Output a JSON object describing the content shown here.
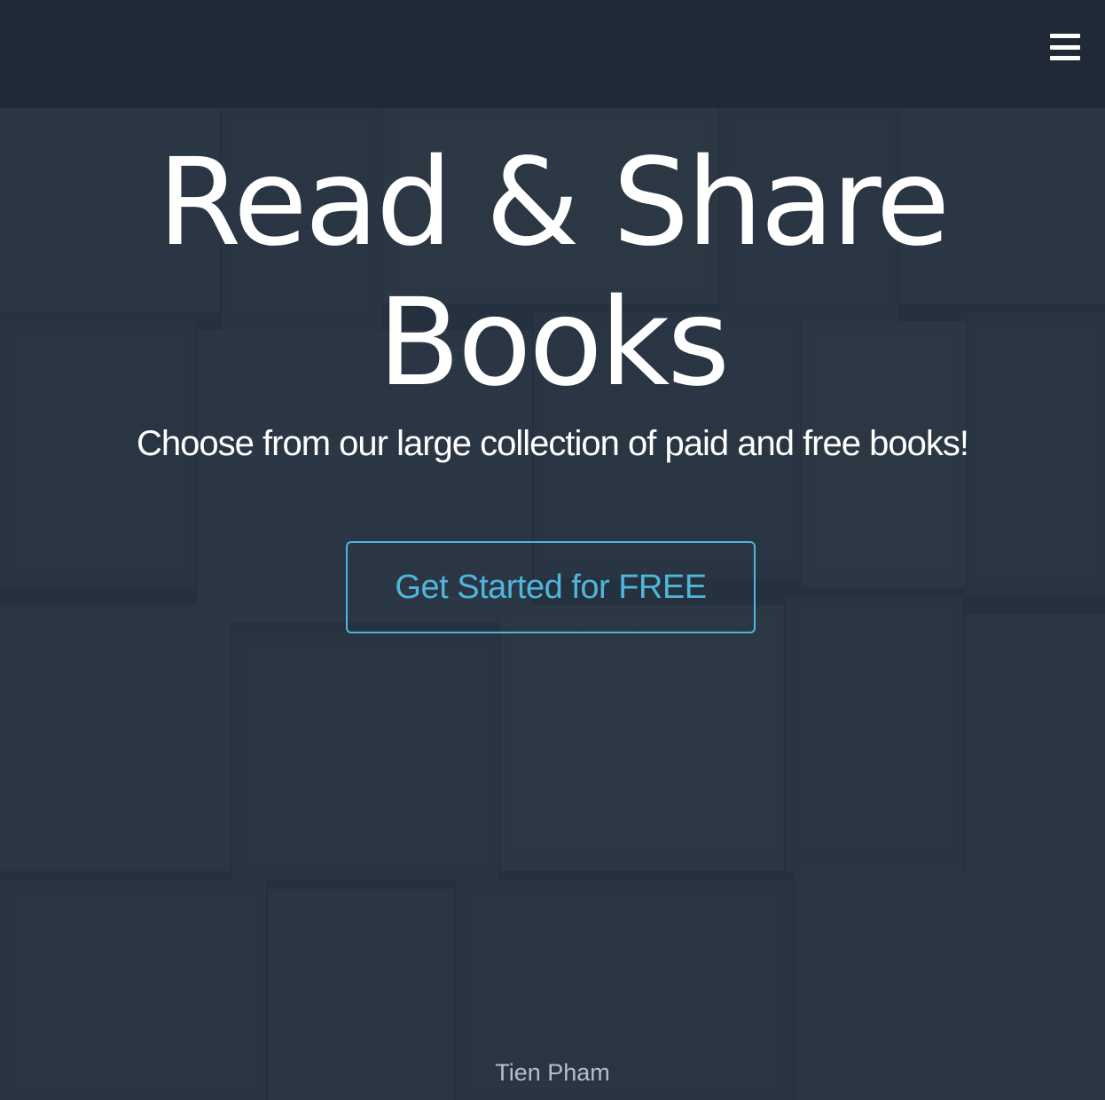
{
  "navbar": {
    "menu_icon": "hamburger-menu-icon"
  },
  "hero": {
    "title_line1": "Read & Share",
    "title_line2": "Books",
    "subtitle": "Choose from our large collection of paid and free books!",
    "cta_label": "Get Started for FREE"
  },
  "footer": {
    "credit": "Tien Pham"
  },
  "colors": {
    "navbar_bg": "#1f2a36",
    "hero_bg": "#2a3644",
    "accent": "#4fb6d9",
    "text": "#ffffff",
    "credit_text": "#b8bec6"
  }
}
